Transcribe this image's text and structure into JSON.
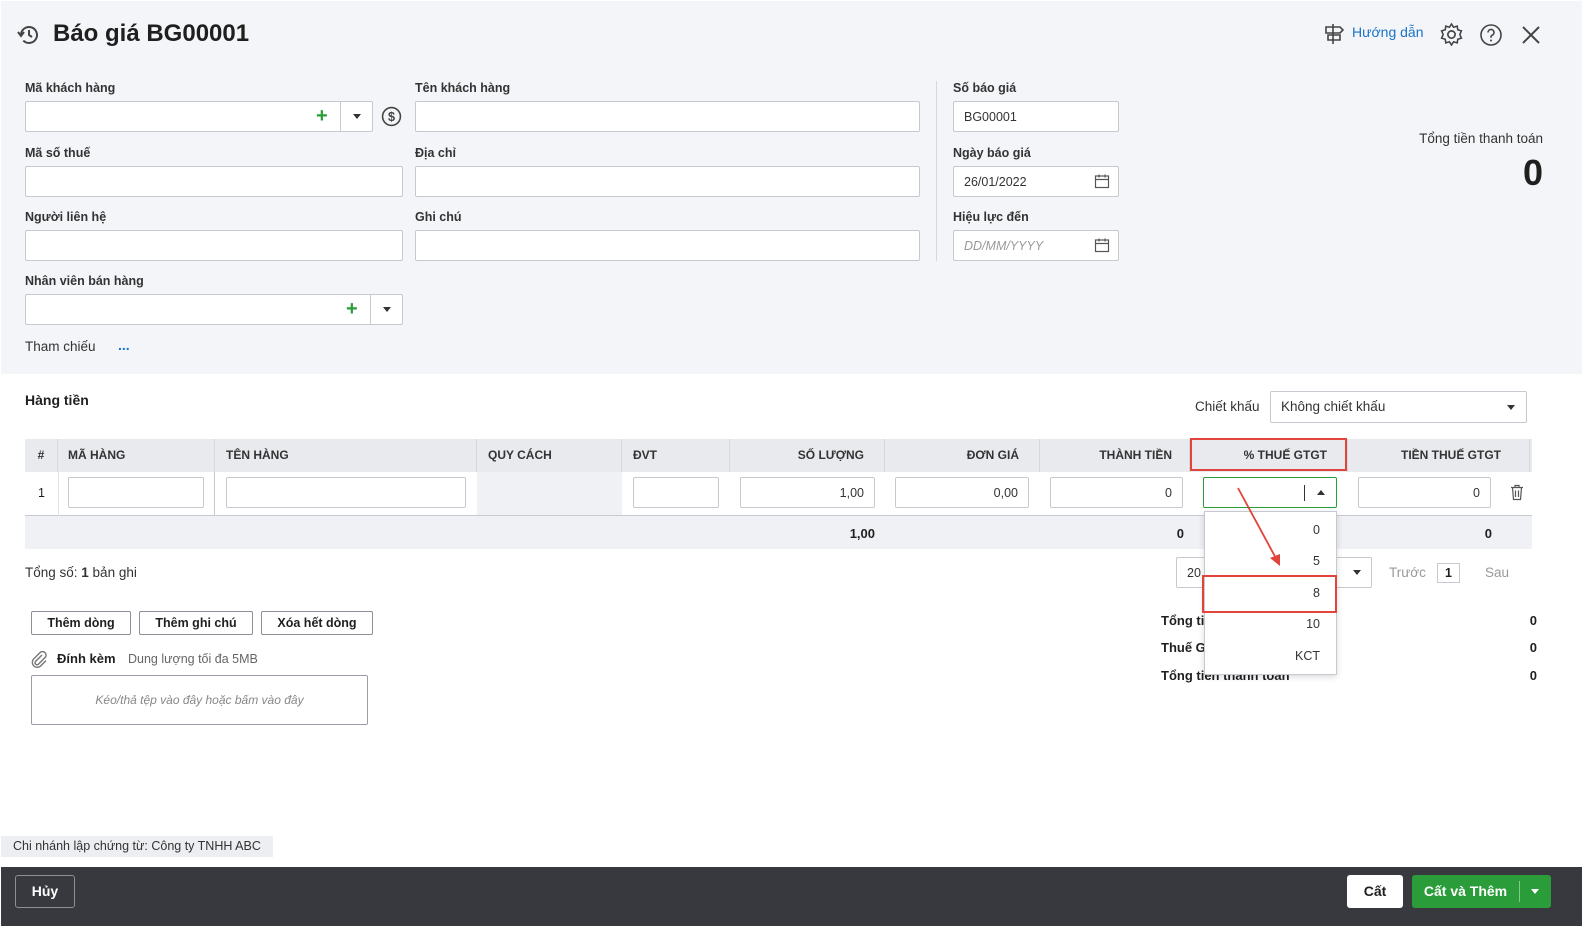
{
  "header": {
    "title": "Báo giá BG00001",
    "guide_label": "Hướng dẫn"
  },
  "form": {
    "customer_code": {
      "label": "Mã khách hàng",
      "value": ""
    },
    "customer_name": {
      "label": "Tên khách hàng",
      "value": ""
    },
    "tax_code": {
      "label": "Mã số thuế",
      "value": ""
    },
    "address": {
      "label": "Địa chỉ",
      "value": ""
    },
    "contact": {
      "label": "Người liên hệ",
      "value": ""
    },
    "note": {
      "label": "Ghi chú",
      "value": ""
    },
    "salesperson": {
      "label": "Nhân viên bán hàng",
      "value": ""
    },
    "reference": {
      "label": "Tham chiếu",
      "link": "..."
    },
    "quote_no": {
      "label": "Số báo giá",
      "value": "BG00001"
    },
    "quote_date": {
      "label": "Ngày báo giá",
      "value": "26/01/2022"
    },
    "valid_until": {
      "label": "Hiệu lực đến",
      "placeholder": "DD/MM/YYYY"
    }
  },
  "total_payment": {
    "label": "Tổng tiền thanh toán",
    "value": "0"
  },
  "goods": {
    "section_title": "Hàng tiền",
    "discount_label": "Chiết khấu",
    "discount_value": "Không chiết khấu",
    "columns": [
      "#",
      "MÃ HÀNG",
      "TÊN HÀNG",
      "QUY CÁCH",
      "ĐVT",
      "SỐ LƯỢNG",
      "ĐƠN GIÁ",
      "THÀNH TIỀN",
      "% THUẾ GTGT",
      "TIỀN THUẾ GTGT"
    ],
    "rows": [
      {
        "index": "1",
        "item_code": "",
        "item_name": "",
        "spec": "",
        "unit": "",
        "qty": "1,00",
        "price": "0,00",
        "amount": "0",
        "vat_pct": "",
        "vat_amount": "0"
      }
    ],
    "totals": {
      "qty": "1,00",
      "amount": "0",
      "vat_amount": "0"
    },
    "vat_options": [
      "0",
      "5",
      "8",
      "10",
      "KCT"
    ],
    "vat_highlight": "8"
  },
  "paging": {
    "total_prefix": "Tổng số: ",
    "total_count": "1",
    "total_suffix": " bản ghi",
    "page_size": "20",
    "prev": "Trước",
    "page": "1",
    "next": "Sau"
  },
  "actions": {
    "add_row": "Thêm dòng",
    "add_note": "Thêm ghi chú",
    "delete_all": "Xóa hết dòng"
  },
  "attachment": {
    "label": "Đính kèm",
    "hint": "Dung lượng tối đa 5MB",
    "drop_text": "Kéo/thả tệp vào đây hoặc bấm vào đây"
  },
  "summary": [
    {
      "label": "Tổng tiền hàng",
      "value": "0"
    },
    {
      "label": "Thuế GTGT",
      "value": "0"
    },
    {
      "label": "Tổng tiền thanh toán",
      "value": "0"
    }
  ],
  "branch": "Chi nhánh lập chứng từ: Công ty TNHH ABC",
  "footer": {
    "cancel": "Hủy",
    "save": "Cất",
    "save_add": "Cất và Thêm"
  },
  "colors": {
    "green": "#2a9d3a",
    "highlight_red": "#e0443a",
    "link_blue": "#1a73c9",
    "footer_bg": "#37393e"
  }
}
